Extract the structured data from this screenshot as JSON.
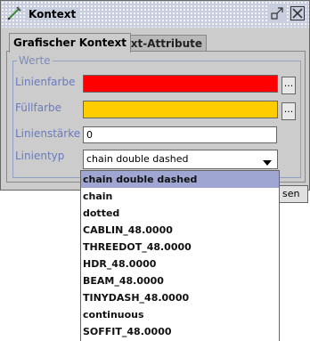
{
  "window": {
    "title": "Kontext",
    "icons": [
      "pen-icon",
      "minimize-icon",
      "close-icon"
    ]
  },
  "tabs": [
    {
      "label": "Grafischer Kontext",
      "active": true
    },
    {
      "label": "Text-Attribute",
      "active": false
    }
  ],
  "group": {
    "title": "Werte"
  },
  "fields": {
    "line_color_label": "Linienfarbe",
    "line_color": "#ff0000",
    "fill_color_label": "Füllfarbe",
    "fill_color": "#ffcc00",
    "line_width_label": "Linienstärke",
    "line_width_value": "0",
    "line_type_label": "Linientyp",
    "line_type_value": "chain double dashed",
    "dots_label": "..."
  },
  "partial_button": {
    "label": "sen"
  },
  "dropdown": {
    "options": [
      "chain double dashed",
      "chain",
      "dotted",
      "CABLIN_48.0000",
      "THREEDOT_48.0000",
      "HDR_48.0000",
      "BEAM_48.0000",
      "TINYDASH_48.0000",
      "continuous",
      "SOFFIT_48.0000"
    ],
    "selected_index": 0
  },
  "colors": {
    "titlebar": "#c8cede",
    "label_blue": "#6a7bbd",
    "selection": "#9fa6d1"
  }
}
